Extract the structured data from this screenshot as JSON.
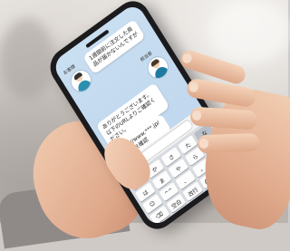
{
  "chat": {
    "customer_name": "お客様",
    "customer_message": "1週間前に注文した商品が届かないんですが",
    "staff_name": "担当者",
    "staff_reply": "ありがとうございます。以下のURLよりご確認ください。",
    "link_text": "https://www.***.jp/",
    "link_caption": "アクセス確認"
  },
  "input": {
    "value": "",
    "send_label": "送"
  },
  "keyboard": {
    "keys": [
      "あ",
      "か",
      "さ",
      "た",
      "な",
      "は",
      "ま",
      "や",
      "ら",
      "わ",
      "☺",
      "^^",
      "、",
      "。",
      "?",
      "⌫",
      "空白",
      "改行",
      "ABC",
      "123"
    ]
  }
}
